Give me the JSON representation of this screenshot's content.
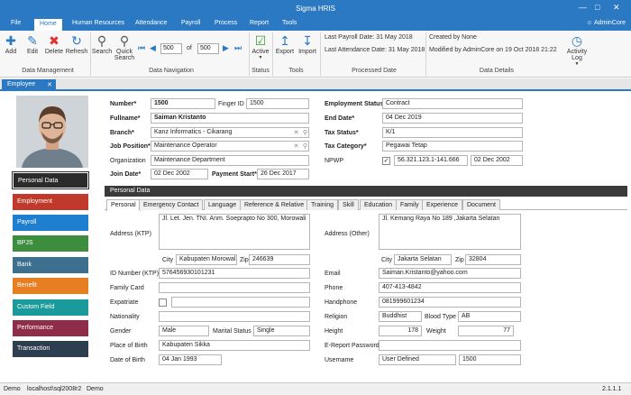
{
  "window": {
    "title": "Sigma HRIS"
  },
  "menu": {
    "items": [
      "File",
      "Home",
      "Human Resources",
      "Attendance",
      "Payroll",
      "Process",
      "Report",
      "Tools"
    ],
    "user": "AdminCore"
  },
  "ribbon": {
    "buttons": {
      "add": "Add",
      "edit": "Edit",
      "delete": "Delete",
      "refresh": "Refresh",
      "search": "Search",
      "quick_search": "Quick Search",
      "active": "Active",
      "export": "Export",
      "import": "Import",
      "activity_log": "Activity Log"
    },
    "nav": {
      "current": "500",
      "of": "of",
      "total": "500"
    },
    "payroll_date": "Last Payroll Date: 31 May 2018",
    "attendance_date": "Last Attendance Date: 31 May 2018",
    "created_by": "Created by None",
    "modified_by": "Modified by AdminCore on 19 Oct 2018  21:22",
    "groups": {
      "data_management": "Data Management",
      "data_navigation": "Data Navigation",
      "status": "Status",
      "tools": "Tools",
      "processed_date": "Processed Date",
      "data_details": "Data Details"
    }
  },
  "doc_tab": {
    "label": "Employee"
  },
  "nav_buttons": [
    {
      "label": "Personal Data",
      "color": "#2b2b2b"
    },
    {
      "label": "Employment",
      "color": "#c0392b"
    },
    {
      "label": "Payroll",
      "color": "#1e7fd0"
    },
    {
      "label": "BPJS",
      "color": "#3c8d3c"
    },
    {
      "label": "Bank",
      "color": "#3d6f8e"
    },
    {
      "label": "Benefit",
      "color": "#e67e22"
    },
    {
      "label": "Custom Field",
      "color": "#1a9a9a"
    },
    {
      "label": "Performance",
      "color": "#8e2c4a"
    },
    {
      "label": "Transaction",
      "color": "#2c3e50"
    }
  ],
  "header_form": {
    "number_label": "Number*",
    "number": "1500",
    "finger_label": "Finger ID",
    "finger": "1500",
    "fullname_label": "Fullname*",
    "fullname": "Saiman Kristanto",
    "branch_label": "Branch*",
    "branch": "Kanz Informatics - Cikarang",
    "position_label": "Job Position*",
    "position": "Maintenance Operator",
    "org_label": "Organization",
    "org": "Maintenance Department",
    "join_label": "Join Date*",
    "join": "02 Dec 2002",
    "paystart_label": "Payment Start*",
    "paystart": "26 Dec 2017",
    "empstatus_label": "Employment Status*",
    "empstatus": "Contract",
    "enddate_label": "End Date*",
    "enddate": "04 Dec 2019",
    "taxstatus_label": "Tax Status*",
    "taxstatus": "K/1",
    "taxcat_label": "Tax Category*",
    "taxcat": "Pegawai Tetap",
    "npwp_label": "NPWP",
    "npwp": "56.321.123.1-141.666",
    "npwp_date": "02 Dec 2002"
  },
  "section_title": "Personal Data",
  "subtabs": [
    "Personal",
    "Emergency Contact",
    "Language",
    "Reference & Relative",
    "Training",
    "Skill",
    "Education",
    "Family",
    "Experience",
    "Document"
  ],
  "personal": {
    "addr_ktp_label": "Address (KTP)",
    "addr_ktp": "Jl. Let. Jen. TNI. Anm. Soeprapto No 300, Morowali",
    "city_label": "City",
    "city_ktp": "Kabupaten Morowal",
    "zip_label": "Zip",
    "zip_ktp": "246639",
    "addr_other_label": "Address (Other)",
    "addr_other": "Jl. Kemang Raya No 189 ,Jakarta Selatan",
    "city_other": "Jakarta Selatan",
    "zip_other": "32804",
    "idnum_label": "ID Number (KTP)",
    "idnum": "576456930101231",
    "email_label": "Email",
    "email": "Saiman.Kristanto@yahoo.com",
    "family_label": "Family Card",
    "family": "",
    "phone_label": "Phone",
    "phone": "407-413-4842",
    "expat_label": "Expatriate",
    "expat": "",
    "handphone_label": "Handphone",
    "handphone": "081999601234",
    "nationality_label": "Nationality",
    "nationality": "",
    "religion_label": "Religion",
    "religion": "Buddhist",
    "blood_label": "Blood Type",
    "blood": "AB",
    "gender_label": "Gender",
    "gender": "Male",
    "marital_label": "Marital Status",
    "marital": "Single",
    "height_label": "Height",
    "height": "178",
    "weight_label": "Weight",
    "weight": "77",
    "pob_label": "Place of Birth",
    "pob": "Kabupaten Sikka",
    "epass_label": "E-Report Password",
    "epass": "",
    "dob_label": "Date of Birth",
    "dob": "04 Jan 1993",
    "username_label": "Username",
    "username": "User Defined",
    "username_num": "1500"
  },
  "status": {
    "s1": "Demo",
    "s2": "localhost\\sql2008r2",
    "s3": "Demo",
    "version": "2.1.1.1"
  }
}
